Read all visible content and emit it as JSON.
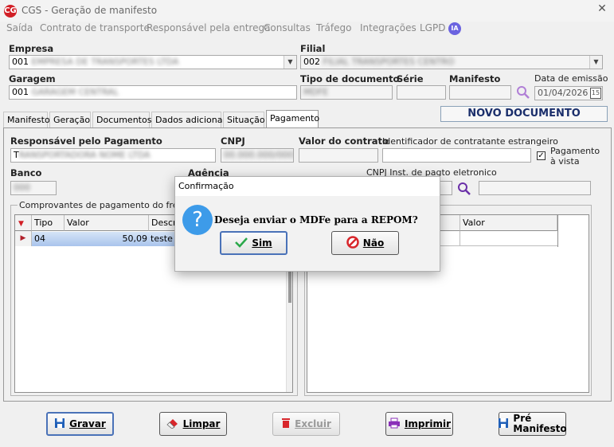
{
  "window": {
    "title": "CGS - Geração de manifesto",
    "logo": "CG"
  },
  "menu": [
    "Saída",
    "Contrato de transporte",
    "Responsável pela entrega",
    "Consultas",
    "Tráfego",
    "Integrações",
    "LGPD"
  ],
  "ia_badge": "IA",
  "form": {
    "empresa_label": "Empresa",
    "empresa_value": "001",
    "filial_label": "Filial",
    "filial_value": "002",
    "garagem_label": "Garagem",
    "garagem_value": "001",
    "tipo_documento_label": "Tipo de documento",
    "serie_label": "Série",
    "manifesto_label": "Manifesto",
    "data_emissao_label": "Data de emissão",
    "data_emissao_value": "01/04/2026",
    "calendar_value": "15"
  },
  "status_text": "NOVO DOCUMENTO",
  "tabs": [
    "Manifesto",
    "Geração",
    "Documentos",
    "Dados adicionais",
    "Situação",
    "Pagamento"
  ],
  "active_tab": "Pagamento",
  "payment": {
    "responsavel_label": "Responsável pelo Pagamento",
    "responsavel_value": "T",
    "cnpj_label": "CNPJ",
    "valor_contrato_label": "Valor do contrato",
    "id_estrangeiro_label": "Identificador de contratante estrangeiro",
    "pagamento_vista_label": "Pagamento à vista",
    "pagamento_vista_checked": true,
    "banco_label": "Banco",
    "agencia_label": "Agência",
    "cnpj_inst_label": "CNPJ Inst. de pagto eletronico"
  },
  "comprovantes": {
    "group_label": "Comprovantes de pagamento do frete",
    "columns": [
      "Tipo",
      "Valor",
      "Descr"
    ],
    "rows": [
      {
        "tipo": "04",
        "valor": "50,09",
        "descr": "teste"
      }
    ]
  },
  "right_grid": {
    "columns": [
      "Valor"
    ]
  },
  "dialog": {
    "title": "Confirmação",
    "message": "Deseja enviar o MDFe para a REPOM?",
    "yes_label": "Sim",
    "no_label": "Não",
    "icon": "question-icon"
  },
  "buttons": {
    "gravar": "Gravar",
    "limpar": "Limpar",
    "excluir": "Excluir",
    "imprimir": "Imprimir",
    "pre_manifesto_1": "Pré",
    "pre_manifesto_2": "Manifesto"
  },
  "colors": {
    "logo": "#d21f26",
    "ia": "#6b63e0",
    "selected_row": "#a9c4ec",
    "question": "#3d9be9",
    "delete": "#d8262b"
  }
}
